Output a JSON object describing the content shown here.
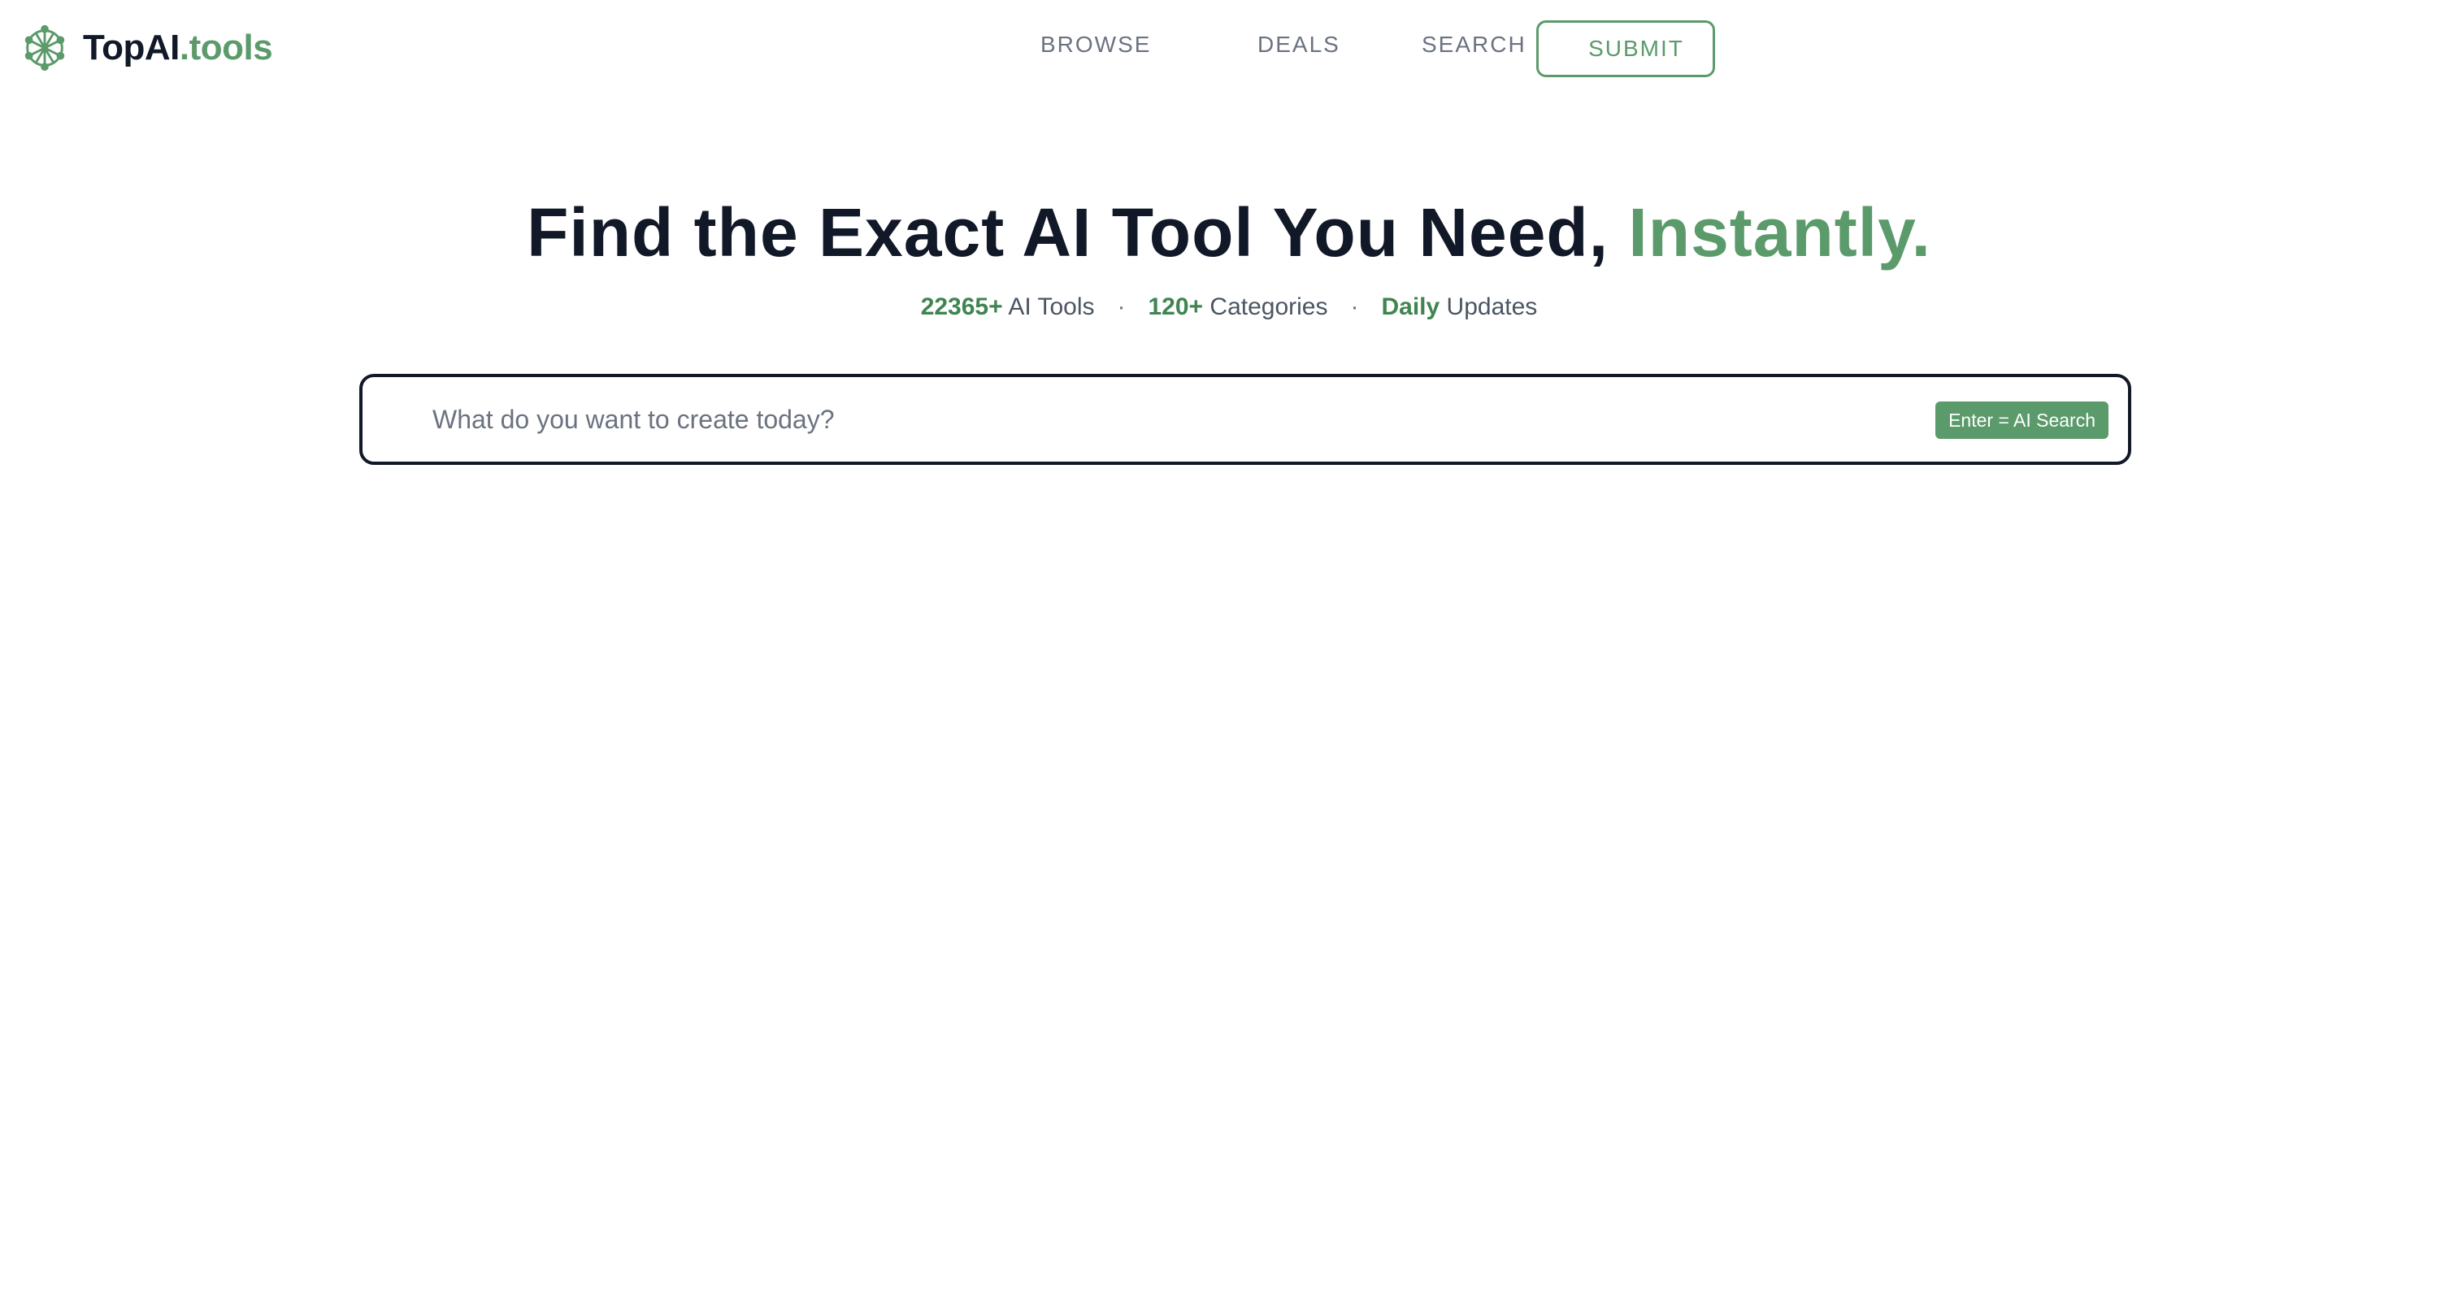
{
  "brand": {
    "name_primary": "TopAI",
    "name_accent": ".tools",
    "logo_icon": "network-globe-icon"
  },
  "nav": {
    "browse": "BROWSE",
    "deals": "DEALS",
    "search": "SEARCH",
    "submit": "SUBMIT"
  },
  "hero": {
    "title_main": "Find the Exact AI Tool You Need, ",
    "title_accent": "Instantly."
  },
  "stats": {
    "tools_count": "22365+",
    "tools_label": " AI Tools",
    "separator": "·",
    "categories_count": "120+",
    "categories_label": " Categories",
    "updates_highlight": "Daily",
    "updates_label": " Updates"
  },
  "search": {
    "placeholder": "What do you want to create today?",
    "value": "",
    "badge": "Enter = AI Search"
  },
  "colors": {
    "accent": "#5b9a6a",
    "stat_accent": "#3f8451",
    "text_dark": "#111827",
    "text_muted": "#6b7280"
  }
}
